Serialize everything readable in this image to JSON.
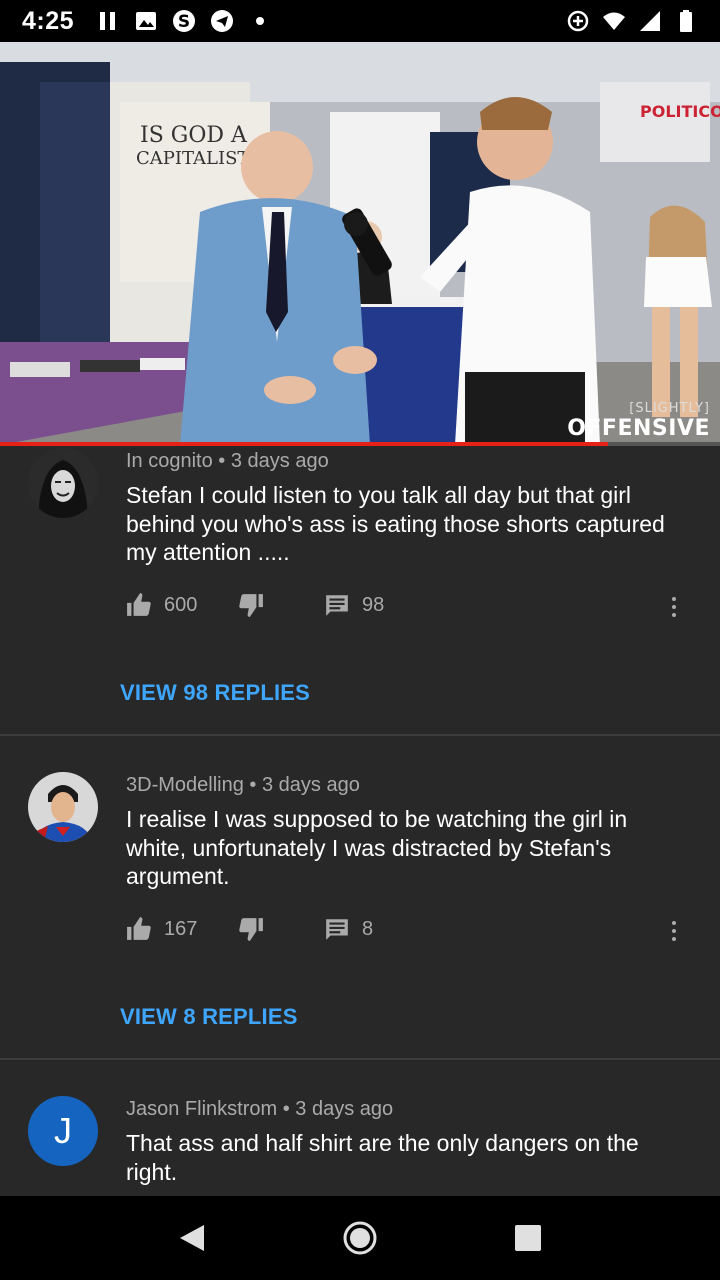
{
  "status_bar": {
    "time": "4:25",
    "left_icons": [
      "pause-icon",
      "image-icon",
      "skype-icon",
      "telegram-icon",
      "dot-icon"
    ],
    "right_icons": [
      "data-saver-icon",
      "wifi-icon",
      "signal-icon",
      "battery-icon"
    ]
  },
  "video": {
    "poster_text_line1": "IS GOD A",
    "poster_text_line2": "CAPITALIST?",
    "banner_text": "POLITICON",
    "watermark_small": "[SLIGHTLY]",
    "watermark_big": "OFFENSIVE",
    "progress_fraction": 0.845,
    "progress_color": "#e62117"
  },
  "comments": [
    {
      "author": "In cognito",
      "age": "3 days ago",
      "text": "Stefan I could listen to you talk all day but that girl behind you who's ass is eating those shorts captured my attention  .....",
      "likes": "600",
      "reply_count": "98",
      "view_replies": "VIEW 98 REPLIES",
      "avatar": "masked-figure"
    },
    {
      "author": "3D-Modelling",
      "age": "3 days ago",
      "text": "I realise I was supposed to be watching the girl in white, unfortunately I was distracted by Stefan's argument.",
      "likes": "167",
      "reply_count": "8",
      "view_replies": "VIEW 8 REPLIES",
      "avatar": "superman"
    },
    {
      "author": "Jason Flinkstrom",
      "age": "3 days ago",
      "text": "That ass and half shirt are the only dangers on the right.",
      "avatar_letter": "J",
      "avatar_color": "#1565c0"
    }
  ],
  "separator": "•",
  "colors": {
    "background": "#282828",
    "link": "#3ea6ff",
    "secondary_text": "#aaaaaa"
  },
  "nav_bar": [
    "back-icon",
    "home-icon",
    "recents-icon"
  ]
}
